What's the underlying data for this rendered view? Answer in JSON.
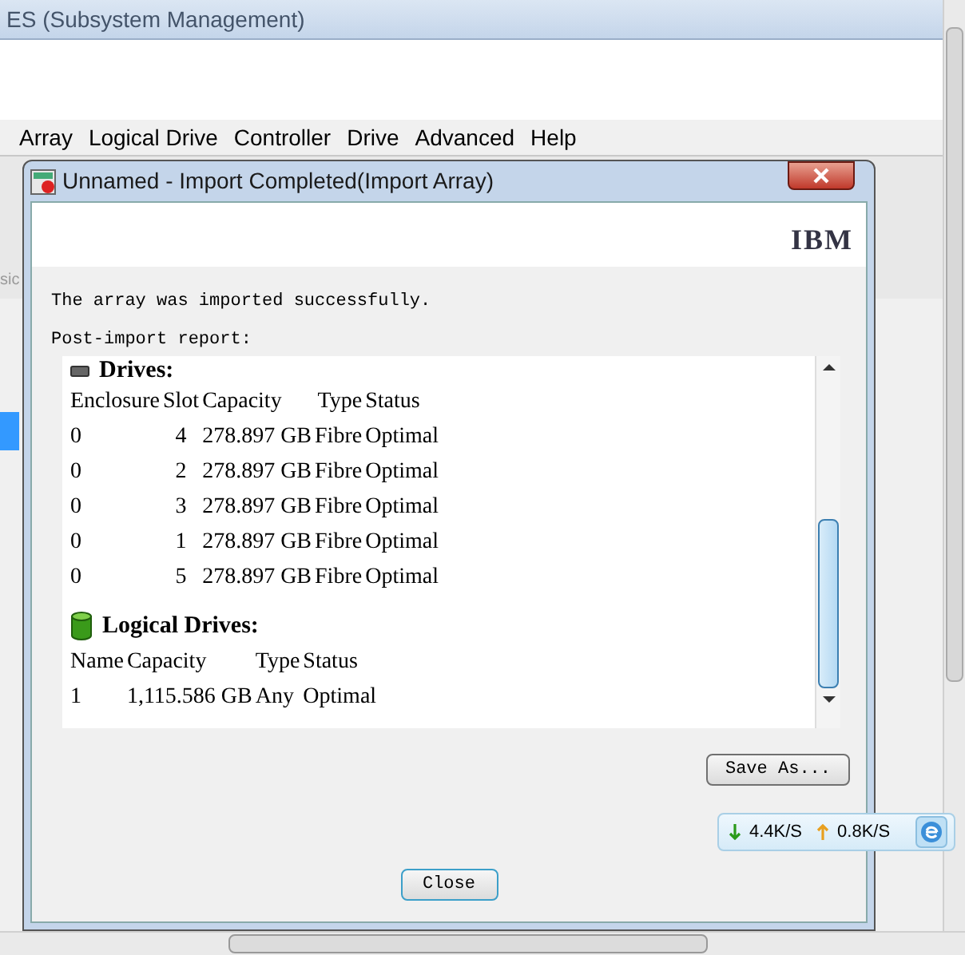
{
  "background_window": {
    "title": "ES (Subsystem Management)",
    "menu": [
      "Array",
      "Logical Drive",
      "Controller",
      "Drive",
      "Advanced",
      "Help"
    ],
    "side_text": "sic"
  },
  "dialog": {
    "title": "Unnamed - Import Completed(Import Array)",
    "logo": "IBM",
    "message": "The array was imported successfully.",
    "report_label": "Post-import report:",
    "drives": {
      "heading": "Drives:",
      "columns": [
        "Enclosure",
        "Slot",
        "Capacity",
        "Type",
        "Status"
      ],
      "rows": [
        [
          "0",
          "4",
          "278.897 GB",
          "Fibre",
          "Optimal"
        ],
        [
          "0",
          "2",
          "278.897 GB",
          "Fibre",
          "Optimal"
        ],
        [
          "0",
          "3",
          "278.897 GB",
          "Fibre",
          "Optimal"
        ],
        [
          "0",
          "1",
          "278.897 GB",
          "Fibre",
          "Optimal"
        ],
        [
          "0",
          "5",
          "278.897 GB",
          "Fibre",
          "Optimal"
        ]
      ]
    },
    "logical_drives": {
      "heading": "Logical Drives:",
      "columns": [
        "Name",
        "Capacity",
        "Type",
        "Status"
      ],
      "rows": [
        [
          "1",
          "1,115.586 GB",
          "Any",
          "Optimal"
        ]
      ]
    },
    "save_as_button": "Save As...",
    "close_button": "Close"
  },
  "network_widget": {
    "download": "4.4K/S",
    "upload": "0.8K/S"
  }
}
